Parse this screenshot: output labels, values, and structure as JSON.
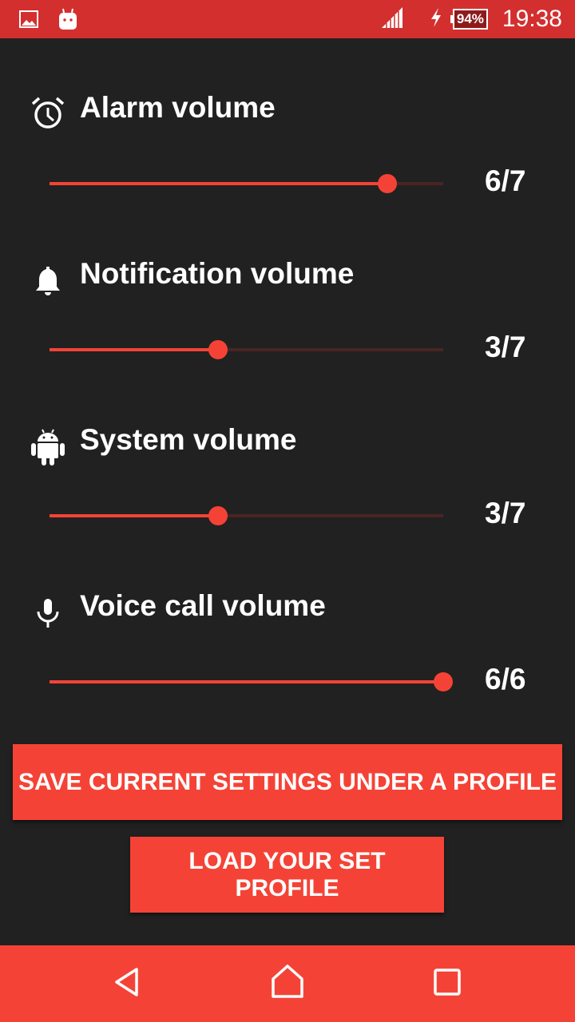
{
  "status_bar": {
    "left_icons": [
      "image-icon",
      "android-robot-icon"
    ],
    "signal_icon": "signal-icon",
    "charging_icon": "charging-bolt-icon",
    "battery": "94%",
    "time": "19:38"
  },
  "volume_sections": [
    {
      "icon": "alarm-clock-icon",
      "title": "Alarm volume",
      "value_label": "6/7",
      "value": 6,
      "max": 7
    },
    {
      "icon": "bell-icon",
      "title": "Notification volume",
      "value_label": "3/7",
      "value": 3,
      "max": 7
    },
    {
      "icon": "android-icon",
      "title": "System volume",
      "value_label": "3/7",
      "value": 3,
      "max": 7
    },
    {
      "icon": "microphone-icon",
      "title": "Voice call volume",
      "value_label": "6/6",
      "value": 6,
      "max": 6
    }
  ],
  "buttons": {
    "save_label": "SAVE CURRENT SETTINGS UNDER A PROFILE",
    "load_label": "LOAD YOUR SET PROFILE"
  },
  "nav_bar": {
    "back": "back-icon",
    "home": "home-icon",
    "recents": "recents-icon"
  },
  "colors": {
    "accent": "#f44336",
    "status_bar": "#d32f2f",
    "background": "#212121"
  }
}
